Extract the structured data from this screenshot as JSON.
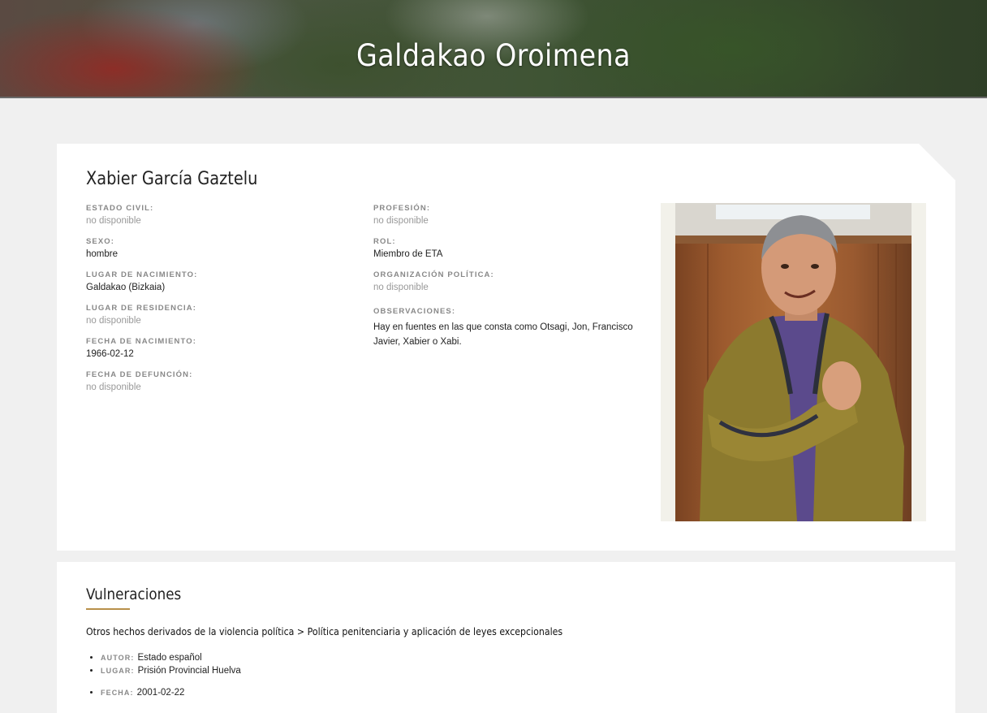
{
  "site": {
    "title": "Galdakao Oroimena"
  },
  "person": {
    "name": "Xabier García Gaztelu",
    "left_fields": [
      {
        "label": "ESTADO CIVIL:",
        "value": "no disponible",
        "available": false
      },
      {
        "label": "SEXO:",
        "value": "hombre",
        "available": true
      },
      {
        "label": "LUGAR DE NACIMIENTO:",
        "value": "Galdakao (Bizkaia)",
        "available": true
      },
      {
        "label": "LUGAR DE RESIDENCIA:",
        "value": "no disponible",
        "available": false
      },
      {
        "label": "FECHA DE NACIMIENTO:",
        "value": "1966-02-12",
        "available": true
      },
      {
        "label": "FECHA DE DEFUNCIÓN:",
        "value": "no disponible",
        "available": false
      }
    ],
    "right_fields": [
      {
        "label": "PROFESIÓN:",
        "value": "no disponible",
        "available": false
      },
      {
        "label": "ROL:",
        "value": "Miembro de ETA",
        "available": true
      },
      {
        "label": "ORGANIZACIÓN POLÍTICA:",
        "value": "no disponible",
        "available": false
      },
      {
        "label": "OBSERVACIONES:",
        "value": "Hay en fuentes en las que consta como Otsagi, Jon, Francisco Javier, Xabier o Xabi.",
        "available": true
      }
    ]
  },
  "vulneraciones": {
    "title": "Vulneraciones",
    "category": "Otros hechos derivados de la violencia política > Política penitenciaria y aplicación de leyes excepcionales",
    "details": [
      {
        "label": "AUTOR:",
        "value": "Estado español"
      },
      {
        "label": "LUGAR:",
        "value": "Prisión Provincial Huelva"
      },
      {
        "label": "FECHA:",
        "value": "2001-02-22"
      }
    ]
  },
  "colors": {
    "accent": "#b8904a",
    "muted_label": "#888888",
    "unavailable": "#999999"
  }
}
